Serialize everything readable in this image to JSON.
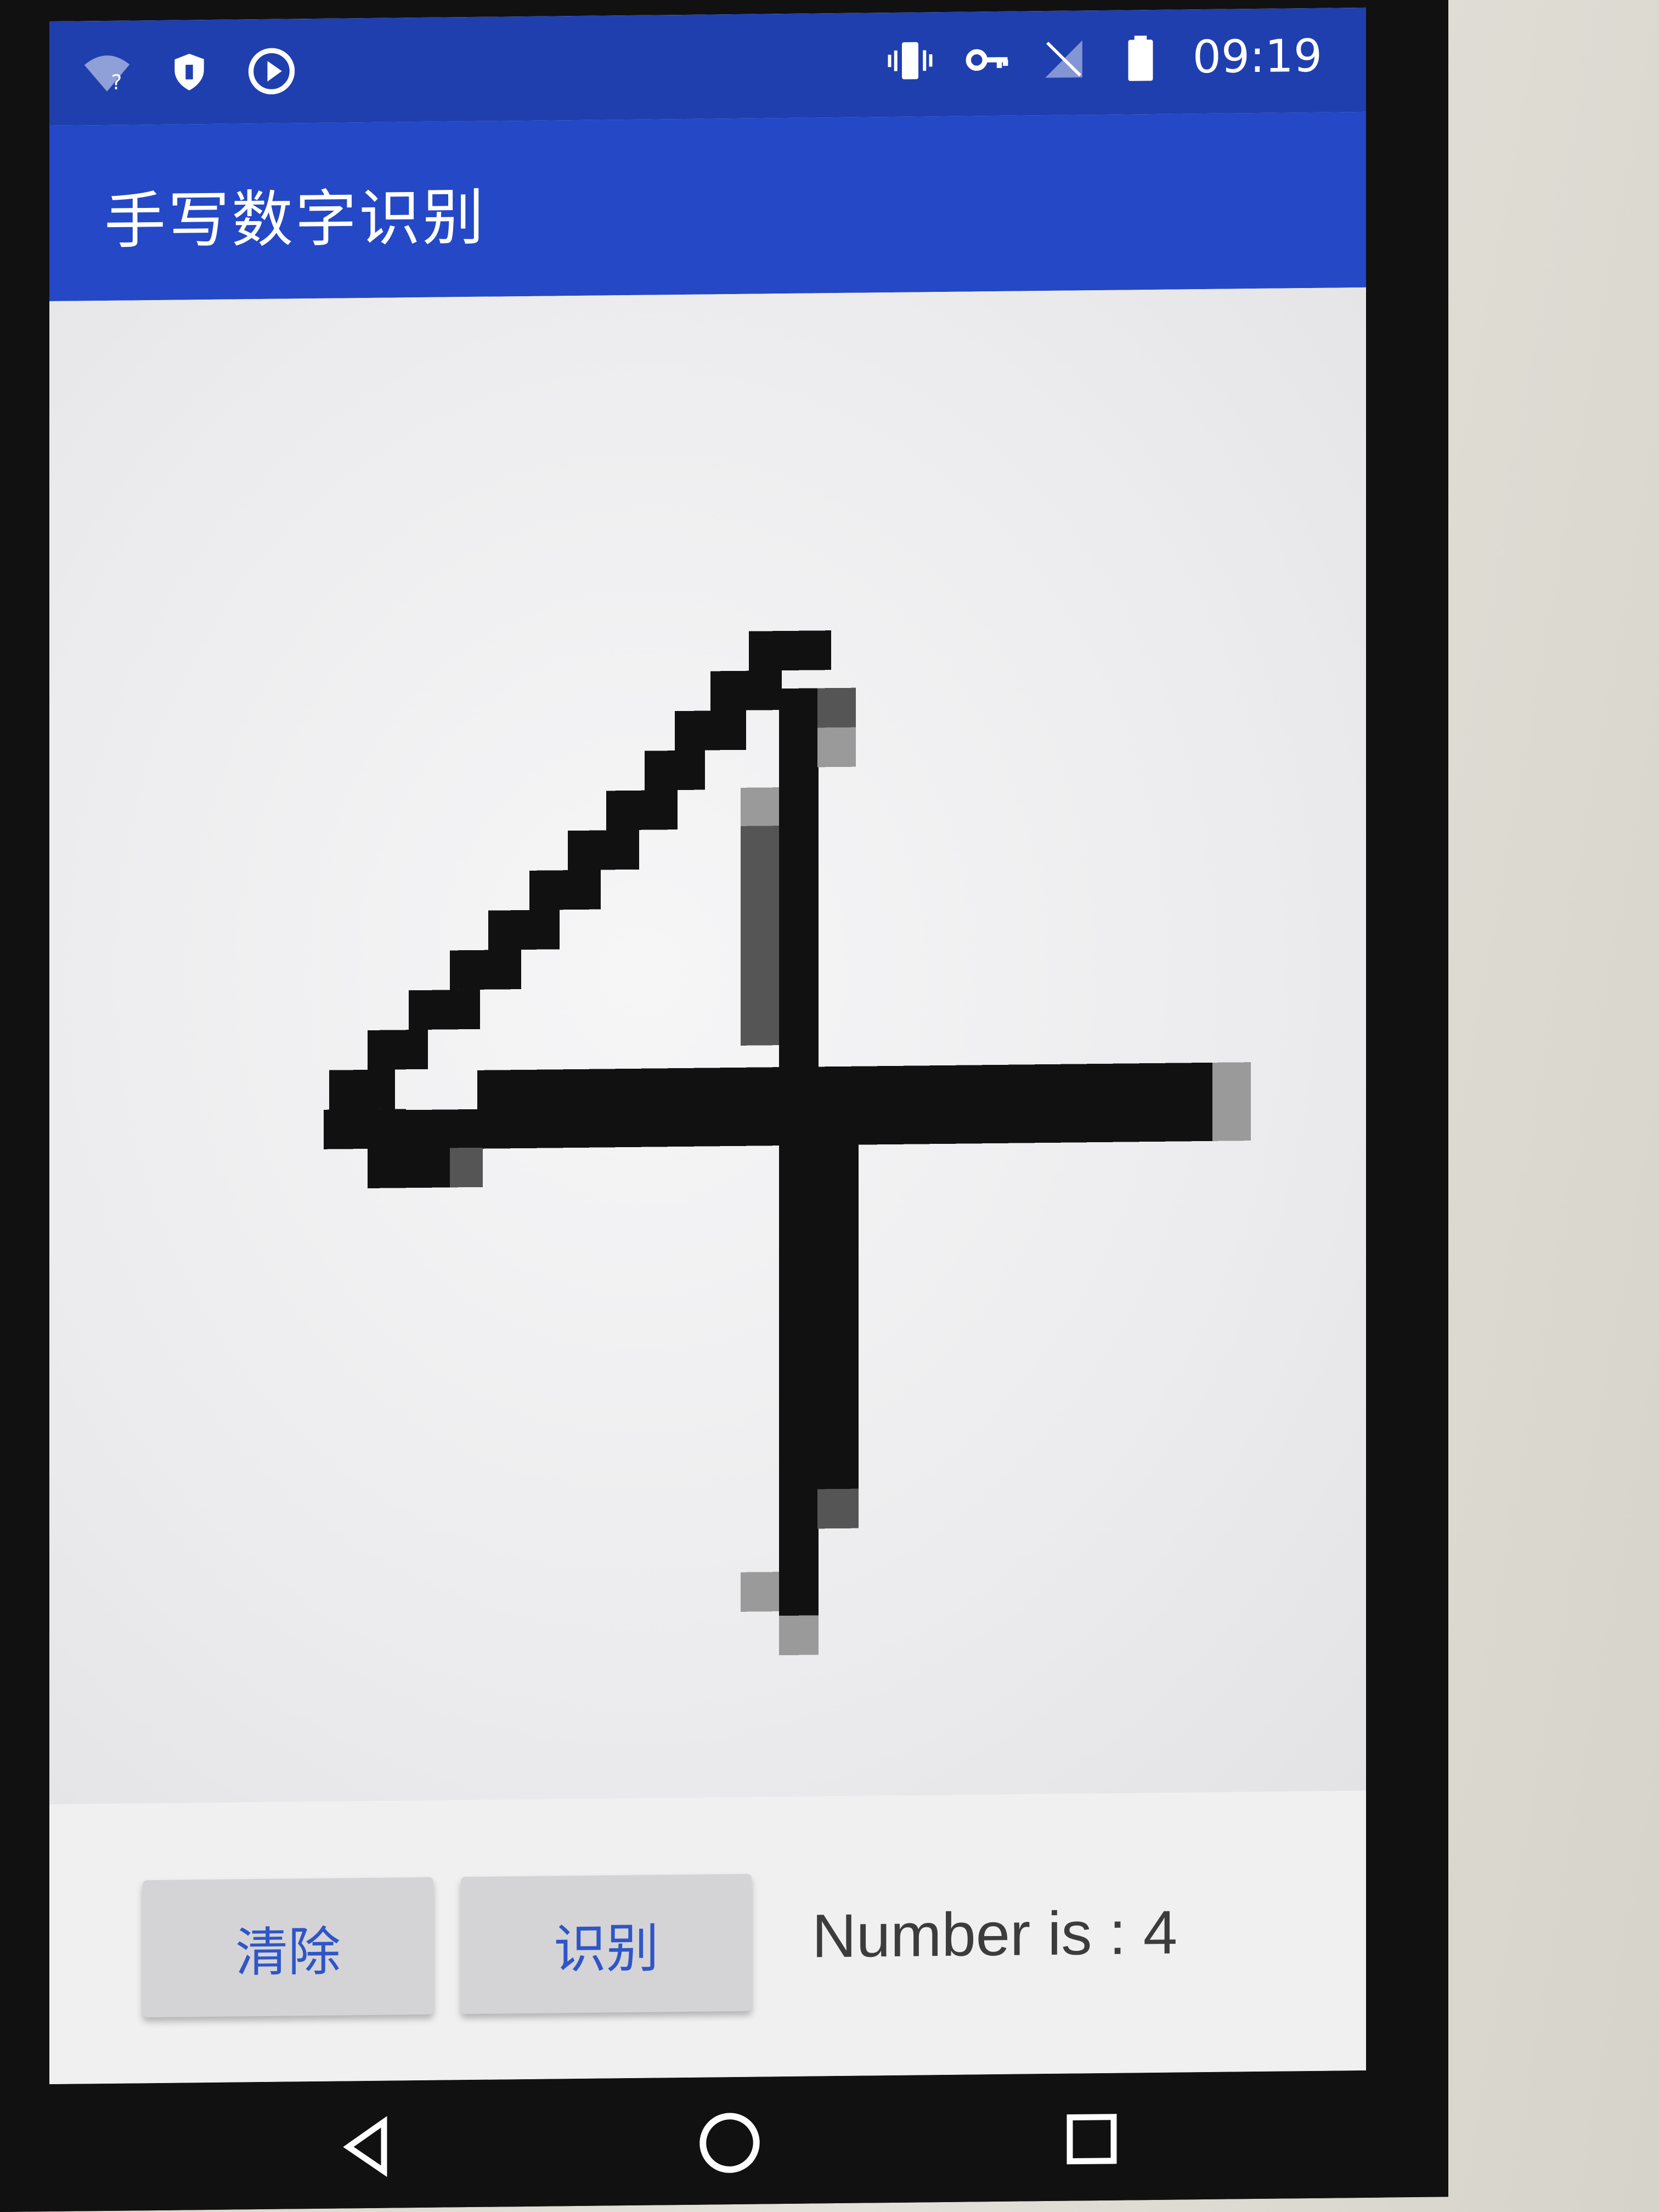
{
  "status_bar": {
    "time": "09:19",
    "left_icons": [
      "wifi-question-icon",
      "vpn-key-shield-icon",
      "play-circle-icon"
    ],
    "right_icons": [
      "vibrate-icon",
      "key-icon",
      "no-sim-icon",
      "battery-icon"
    ]
  },
  "app_bar": {
    "title": "手写数字识别"
  },
  "canvas": {
    "drawn_digit": "4"
  },
  "controls": {
    "clear_label": "清除",
    "recognize_label": "识别",
    "result_text": "Number is : 4"
  },
  "nav_bar": {
    "icons": [
      "back-icon",
      "home-icon",
      "recents-icon"
    ]
  },
  "colors": {
    "primary": "#2448c6",
    "primary_dark": "#1f3faf",
    "button_text": "#2f55c8"
  }
}
